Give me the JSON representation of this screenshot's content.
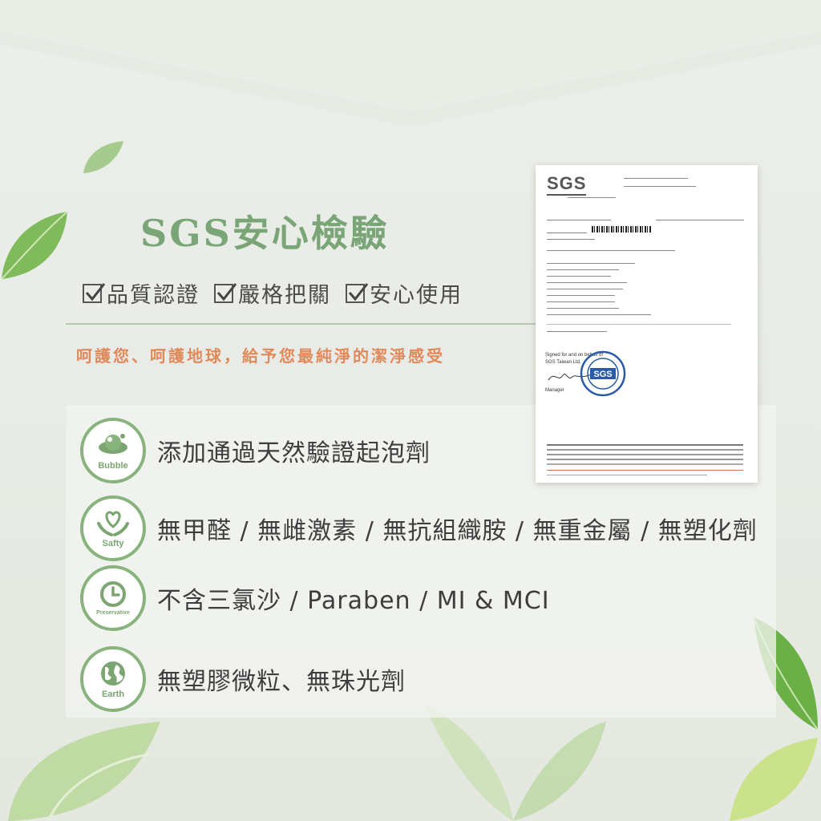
{
  "title": "SGS安心檢驗",
  "checks": [
    "品質認證",
    "嚴格把關",
    "安心使用"
  ],
  "slogan": "呵護您、呵護地球，給予您最純淨的潔淨感受",
  "features": [
    {
      "icon": "bubble-icon",
      "badge": "Bubble",
      "text": "添加通過天然驗證起泡劑"
    },
    {
      "icon": "heart-hands-icon",
      "badge": "Safty",
      "text": "無甲醛 / 無雌激素 / 無抗組織胺 / 無重金屬 / 無塑化劑"
    },
    {
      "icon": "clock-icon",
      "badge": "Preservative",
      "text": "不含三氯沙 / Paraben / MI & MCI"
    },
    {
      "icon": "globe-icon",
      "badge": "Earth",
      "text": "無塑膠微粒、無珠光劑"
    }
  ],
  "certificate": {
    "logo": "SGS",
    "stamp": "SGS",
    "signed_label": "Signed for and on behalf of",
    "signer_company": "SGS Taiwan Ltd.",
    "signer_title": "Manager"
  },
  "colors": {
    "title_green": "#7aa677",
    "badge_green": "#88b37d",
    "slogan_orange": "#e08a5c",
    "stamp_blue": "#2b5aa8"
  }
}
